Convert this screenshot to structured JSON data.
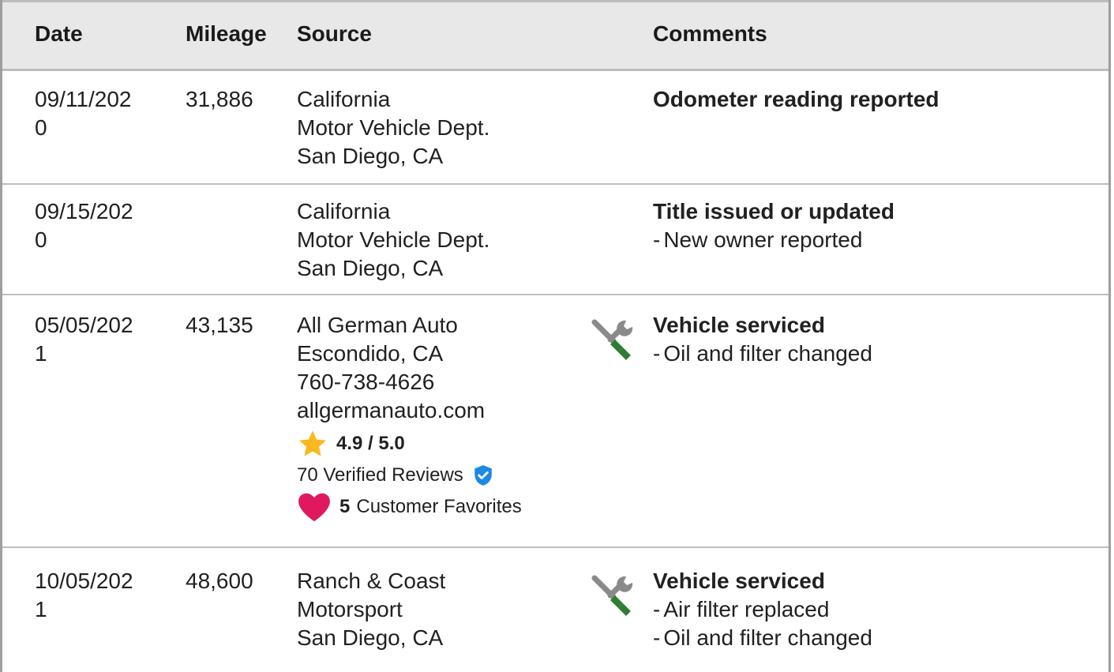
{
  "header": {
    "date": "Date",
    "mileage": "Mileage",
    "source": "Source",
    "comments": "Comments"
  },
  "rows": [
    {
      "date": [
        "09/11/202",
        "0"
      ],
      "mileage": "31,886",
      "source": [
        "California",
        "Motor Vehicle Dept.",
        "San Diego, CA"
      ],
      "title": "Odometer reading reported",
      "details": []
    },
    {
      "date": [
        "09/15/202",
        "0"
      ],
      "mileage": "",
      "source": [
        "California",
        "Motor Vehicle Dept.",
        "San Diego, CA"
      ],
      "title": "Title issued or updated",
      "details": [
        "New owner reported"
      ]
    },
    {
      "date": [
        "05/05/202",
        "1"
      ],
      "mileage": "43,135",
      "source": [
        "All German Auto",
        "Escondido, CA",
        "760-738-4626",
        "allgermanauto.com"
      ],
      "rating": "4.9 / 5.0",
      "reviews": "70 Verified Reviews",
      "favorites_count": "5",
      "favorites_label": "Customer Favorites",
      "icon": "service-tools-icon",
      "title": "Vehicle serviced",
      "details": [
        "Oil and filter changed"
      ]
    },
    {
      "date": [
        "10/05/202",
        "1"
      ],
      "mileage": "48,600",
      "source": [
        "Ranch & Coast",
        "Motorsport",
        "San Diego, CA"
      ],
      "icon": "service-tools-icon",
      "title": "Vehicle serviced",
      "details": [
        "Air filter replaced",
        "Oil and filter changed"
      ]
    }
  ],
  "colors": {
    "header_bg": "#e8e8e8",
    "border": "#bdbdbd",
    "star": "#f9b820",
    "heart": "#e0195f",
    "shield": "#1e88e5",
    "wrench": "#8a8a8a",
    "screwdriver": "#2e7d32"
  },
  "dash": "-"
}
